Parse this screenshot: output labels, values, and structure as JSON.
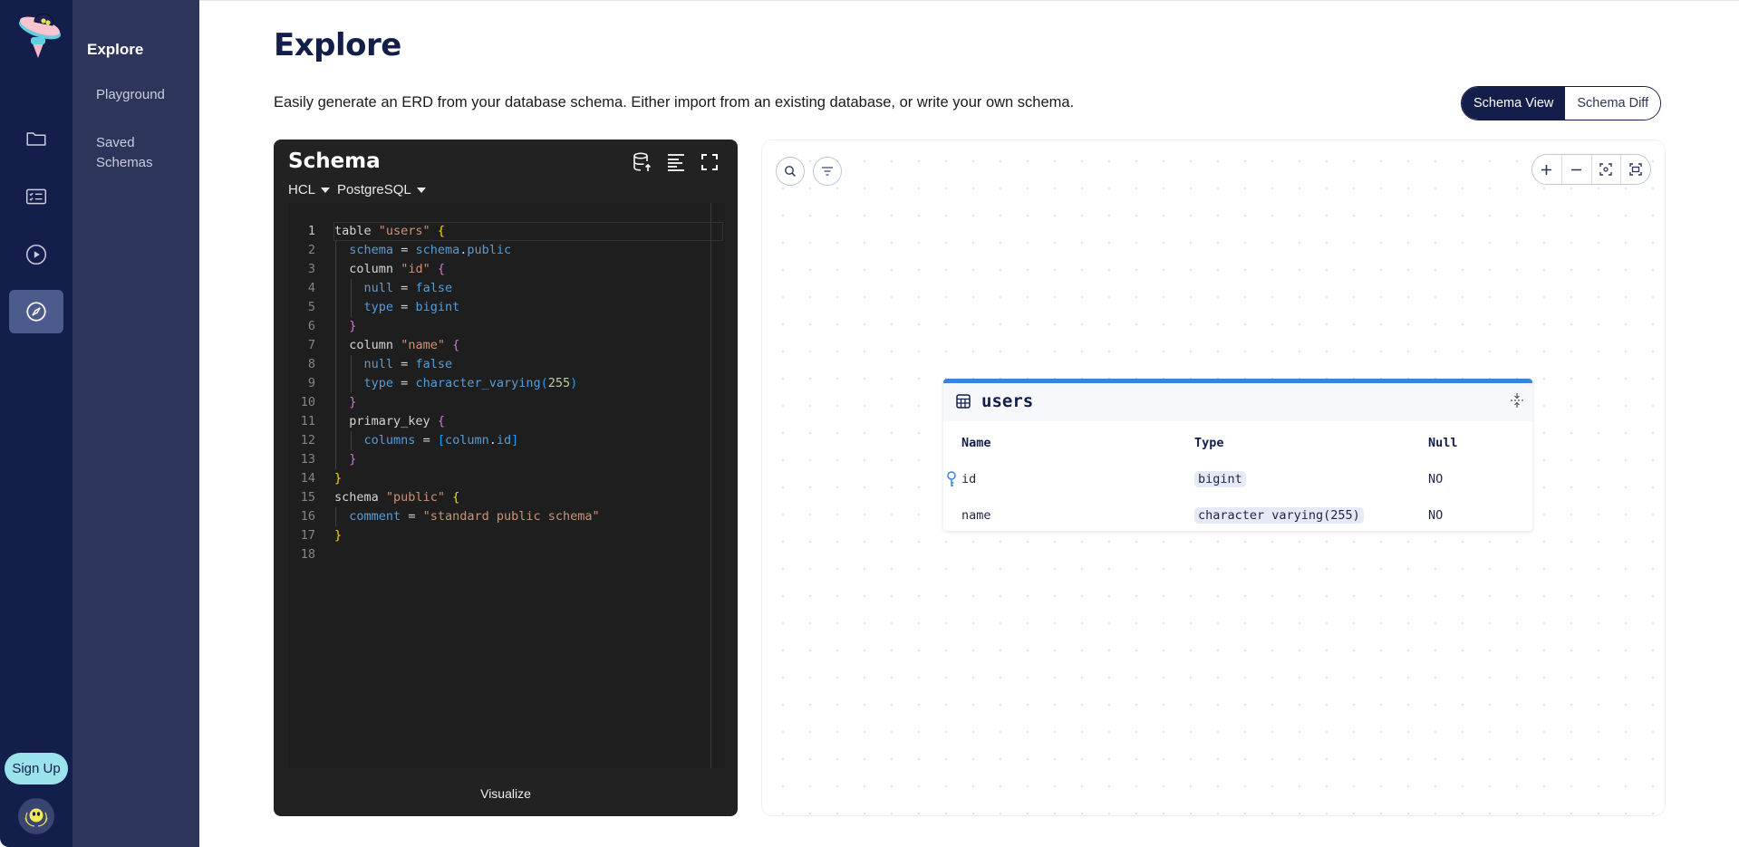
{
  "rail": {
    "logo": "ufo-logo",
    "items": [
      {
        "icon": "folder-icon",
        "active": false
      },
      {
        "icon": "checklist-icon",
        "active": false
      },
      {
        "icon": "play-circle-icon",
        "active": false
      },
      {
        "icon": "compass-icon",
        "active": true
      }
    ],
    "signup_label": "Sign Up",
    "avatar": "creature-avatar"
  },
  "subnav": {
    "title": "Explore",
    "items": [
      {
        "label": "Playground"
      },
      {
        "label": "Saved Schemas"
      }
    ]
  },
  "header": {
    "title": "Explore",
    "description": "Easily generate an ERD from your database schema. Either import from an existing database, or write your own schema.",
    "view_toggle": {
      "options": [
        "Schema View",
        "Schema Diff"
      ],
      "selected": "Schema View"
    }
  },
  "editor": {
    "title": "Schema",
    "toolbar_icons": [
      "database-import-icon",
      "format-align-icon",
      "fullscreen-icon"
    ],
    "format_select": "HCL",
    "dialect_select": "PostgreSQL",
    "current_line": 1,
    "lines": [
      "table \"users\" {",
      "  schema = schema.public",
      "  column \"id\" {",
      "    null = false",
      "    type = bigint",
      "  }",
      "  column \"name\" {",
      "    null = false",
      "    type = character_varying(255)",
      "  }",
      "  primary_key {",
      "    columns = [column.id]",
      "  }",
      "}",
      "schema \"public\" {",
      "  comment = \"standard public schema\"",
      "}",
      ""
    ],
    "visualize_label": "Visualize"
  },
  "canvas": {
    "left_tools": [
      "search-icon",
      "filter-icon"
    ],
    "zoom_tools": [
      "zoom-in-icon",
      "zoom-out-icon",
      "focus-icon",
      "fit-view-icon"
    ],
    "accent_color": "#3a84e0",
    "table": {
      "name": "users",
      "columns_header": [
        "Name",
        "Type",
        "Null"
      ],
      "rows": [
        {
          "name": "id",
          "type": "bigint",
          "null": "NO",
          "primary_key": true
        },
        {
          "name": "name",
          "type": "character varying(255)",
          "null": "NO",
          "primary_key": false
        }
      ]
    }
  }
}
